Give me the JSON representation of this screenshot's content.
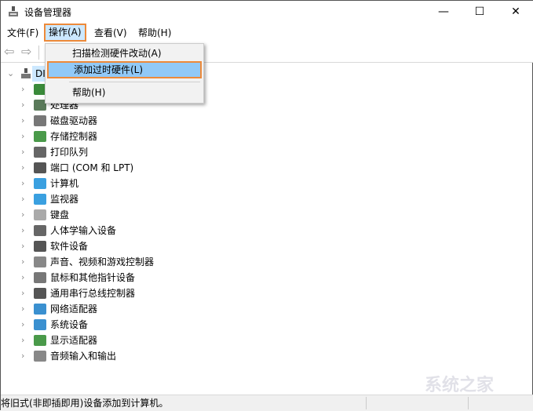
{
  "window": {
    "title": "设备管理器",
    "minimize": "—",
    "maximize": "☐",
    "close": "✕"
  },
  "menubar": [
    {
      "label": "文件(F)"
    },
    {
      "label": "操作(A)"
    },
    {
      "label": "查看(V)"
    },
    {
      "label": "帮助(H)"
    }
  ],
  "action_menu": {
    "items": [
      {
        "label": "扫描检测硬件改动(A)"
      },
      {
        "label": "添加过时硬件(L)",
        "highlighted": true
      },
      {
        "label": "帮助(H)"
      }
    ]
  },
  "toolbar": {
    "back_icon": "arrow-left-icon",
    "forward_icon": "arrow-right-icon"
  },
  "tree": {
    "root": {
      "label": "DI",
      "expanded": true
    },
    "items": [
      {
        "label": "",
        "color": "#3a8a3a"
      },
      {
        "label": "处理器",
        "color": "#5a7a5a"
      },
      {
        "label": "磁盘驱动器",
        "color": "#777"
      },
      {
        "label": "存储控制器",
        "color": "#4a9a4a"
      },
      {
        "label": "打印队列",
        "color": "#666"
      },
      {
        "label": "端口 (COM 和 LPT)",
        "color": "#555"
      },
      {
        "label": "计算机",
        "color": "#3aa0e0"
      },
      {
        "label": "监视器",
        "color": "#3aa0e0"
      },
      {
        "label": "键盘",
        "color": "#aaa"
      },
      {
        "label": "人体学输入设备",
        "color": "#666"
      },
      {
        "label": "软件设备",
        "color": "#555"
      },
      {
        "label": "声音、视频和游戏控制器",
        "color": "#888"
      },
      {
        "label": "鼠标和其他指针设备",
        "color": "#777"
      },
      {
        "label": "通用串行总线控制器",
        "color": "#555"
      },
      {
        "label": "网络适配器",
        "color": "#3a90d0"
      },
      {
        "label": "系统设备",
        "color": "#3a90d0"
      },
      {
        "label": "显示适配器",
        "color": "#4a9a4a"
      },
      {
        "label": "音频输入和输出",
        "color": "#888"
      }
    ]
  },
  "status": {
    "text": "将旧式(非即插即用)设备添加到计算机。"
  },
  "watermark": "系统之家"
}
